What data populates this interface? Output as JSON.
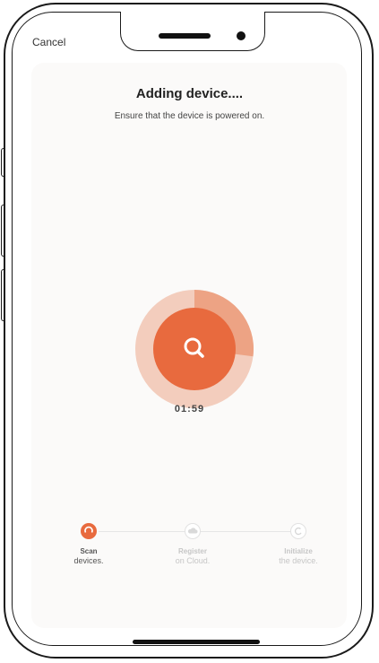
{
  "header": {
    "cancel_label": "Cancel"
  },
  "main": {
    "title": "Adding device....",
    "subtitle": "Ensure that the device is powered on.",
    "timer": "01:59",
    "scan_progress": 0.27
  },
  "steps": [
    {
      "line1": "Scan",
      "line2": "devices.",
      "icon": "scan-icon",
      "state": "active"
    },
    {
      "line1": "Register",
      "line2": "on Cloud.",
      "icon": "cloud-icon",
      "state": "pending"
    },
    {
      "line1": "Initialize",
      "line2": "the device.",
      "icon": "refresh-icon",
      "state": "pending"
    }
  ],
  "colors": {
    "accent": "#e86a3e",
    "ring_light": "#f3c9b7",
    "ring_mid": "#eea07f",
    "inactive": "#d6d6d6"
  }
}
